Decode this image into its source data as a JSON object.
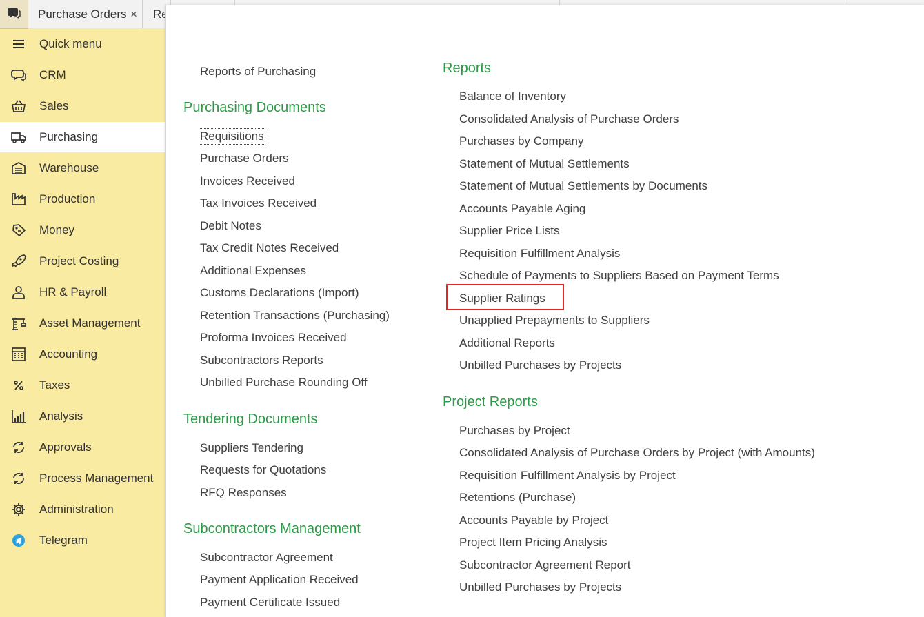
{
  "tabs": {
    "items": [
      {
        "label": "Purchase Orders",
        "close": "×"
      },
      {
        "label": "Re"
      }
    ]
  },
  "sidebar": {
    "items": [
      {
        "label": "Quick menu",
        "icon": "menu-icon"
      },
      {
        "label": "CRM",
        "icon": "crm-chat-icon"
      },
      {
        "label": "Sales",
        "icon": "basket-icon"
      },
      {
        "label": "Purchasing",
        "icon": "truck-icon",
        "active": true
      },
      {
        "label": "Warehouse",
        "icon": "warehouse-icon"
      },
      {
        "label": "Production",
        "icon": "factory-icon"
      },
      {
        "label": "Money",
        "icon": "money-tag-icon"
      },
      {
        "label": "Project Costing",
        "icon": "rocket-icon"
      },
      {
        "label": "HR & Payroll",
        "icon": "person-icon"
      },
      {
        "label": "Asset Management",
        "icon": "crane-icon"
      },
      {
        "label": "Accounting",
        "icon": "calculator-icon"
      },
      {
        "label": "Taxes",
        "icon": "percent-icon"
      },
      {
        "label": "Analysis",
        "icon": "bar-chart-icon"
      },
      {
        "label": "Approvals",
        "icon": "cycle-icon"
      },
      {
        "label": "Process Management",
        "icon": "process-cycle-icon"
      },
      {
        "label": "Administration",
        "icon": "gear-icon"
      },
      {
        "label": "Telegram",
        "icon": "telegram-icon"
      }
    ]
  },
  "left_column": {
    "top_link": "Reports of Purchasing",
    "purchasing_documents": {
      "title": "Purchasing Documents",
      "items": [
        "Requisitions",
        "Purchase Orders",
        "Invoices Received",
        "Tax Invoices Received",
        "Debit Notes",
        "Tax Credit Notes Received",
        "Additional Expenses",
        "Customs Declarations (Import)",
        "Retention Transactions (Purchasing)",
        "Proforma Invoices Received",
        "Subcontractors Reports",
        "Unbilled Purchase Rounding Off"
      ]
    },
    "tendering_documents": {
      "title": "Tendering Documents",
      "items": [
        "Suppliers Tendering",
        "Requests for Quotations",
        "RFQ Responses"
      ]
    },
    "subcontractors_management": {
      "title": "Subcontractors Management",
      "items": [
        "Subcontractor Agreement",
        "Payment Application Received",
        "Payment Certificate Issued"
      ]
    }
  },
  "right_column": {
    "reports": {
      "title": "Reports",
      "items": [
        "Balance of Inventory",
        "Consolidated Analysis of Purchase Orders",
        "Purchases by Company",
        "Statement of Mutual Settlements",
        "Statement of Mutual Settlements by Documents",
        "Accounts Payable Aging",
        "Supplier Price Lists",
        "Requisition Fulfillment Analysis",
        "Schedule of Payments to Suppliers Based on Payment Terms",
        "Supplier Ratings",
        "Unapplied Prepayments to Suppliers",
        "Additional Reports",
        "Unbilled Purchases by Projects"
      ]
    },
    "project_reports": {
      "title": "Project Reports",
      "items": [
        "Purchases by Project",
        "Consolidated Analysis of Purchase Orders by Project (with Amounts)",
        "Requisition Fulfillment Analysis by Project",
        "Retentions (Purchase)",
        "Accounts Payable by Project",
        "Project Item Pricing Analysis",
        "Subcontractor Agreement Report",
        "Unbilled Purchases by Projects"
      ]
    }
  },
  "colors": {
    "sidebar_bg": "#faeba3",
    "heading": "#2c9b47",
    "highlight": "#e02828"
  }
}
